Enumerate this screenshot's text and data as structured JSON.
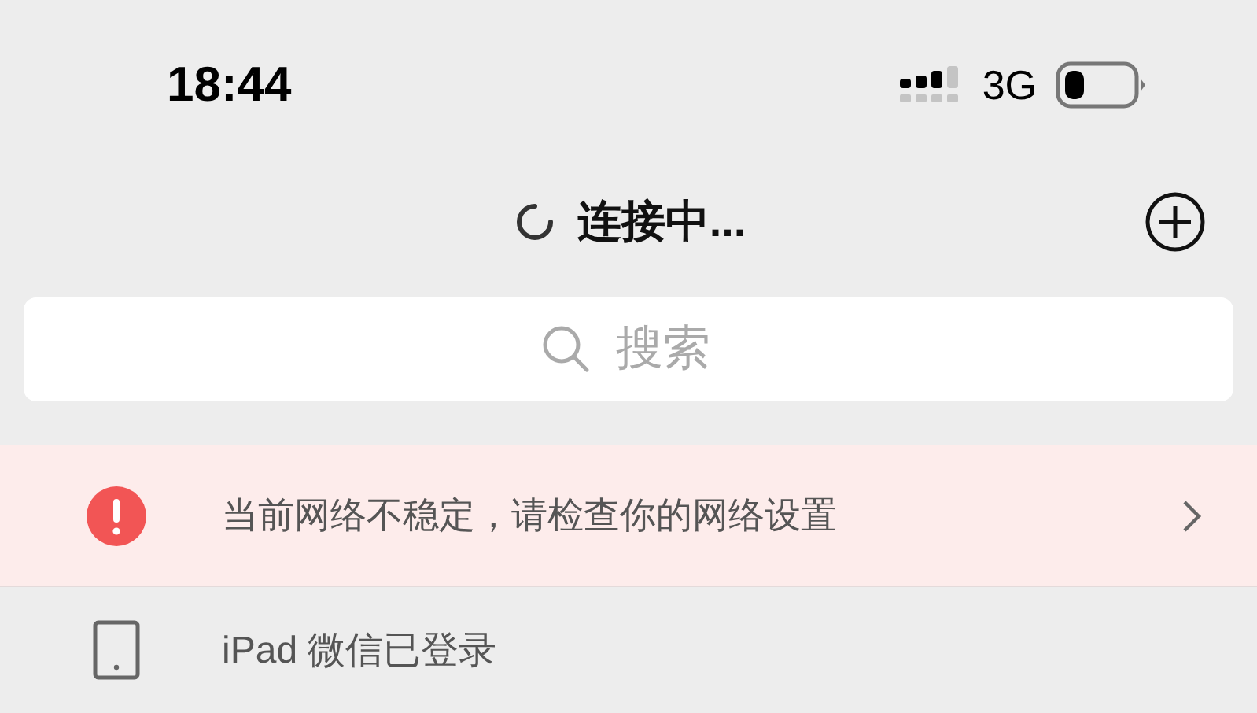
{
  "status_bar": {
    "time": "18:44",
    "network": "3G"
  },
  "nav_bar": {
    "title": "连接中...",
    "loading": true
  },
  "search": {
    "placeholder": "搜索"
  },
  "alert_banner": {
    "text": "当前网络不稳定，请检查你的网络设置"
  },
  "device_notice": {
    "text": "iPad 微信已登录"
  }
}
